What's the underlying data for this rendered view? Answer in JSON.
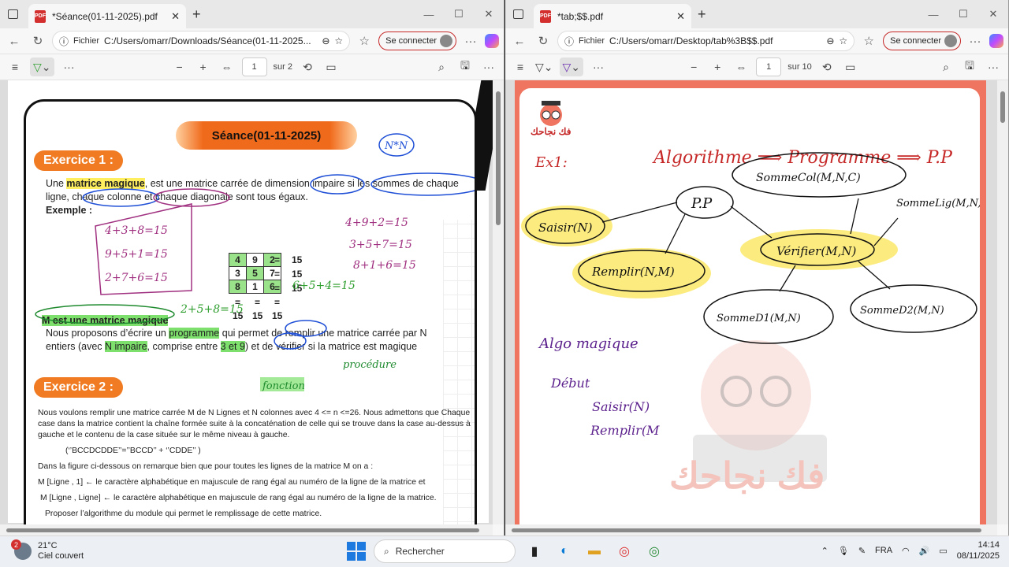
{
  "left": {
    "tab_title": "*Séance(01-11-2025).pdf",
    "addr_label": "Fichier",
    "url": "C:/Users/omarr/Downloads/Séance(01-11-2025...",
    "signin": "Se connecter",
    "page": "1",
    "page_total": "sur 2",
    "doc": {
      "seance_title": "Séance(01-11-2025)",
      "exo1": "Exercice 1 :",
      "l1a": "Une ",
      "l1b": "matrice magique",
      "l1c": ", est une matrice carrée de dimension impaire si les sommes de chaque",
      "l2": "ligne, chaque colonne et chaque diagonale sont tous égaux.",
      "exemple": "Exemple :",
      "matrix": [
        [
          "4",
          "9",
          "2"
        ],
        [
          "3",
          "5",
          "7"
        ],
        [
          "8",
          "1",
          "6"
        ]
      ],
      "row_eq": "=",
      "row_sum": "15",
      "col_sums": [
        "15",
        "15",
        "15"
      ],
      "magic": "M est une matrice magique",
      "p1a": "Nous proposons d’écrire un ",
      "p1b": "programme",
      "p1c": " qui permet de remplir une matrice carrée par N",
      "p2a": "entiers (avec ",
      "p2b": "N impaire",
      "p2c": ", comprise entre ",
      "p2d": "3 et 9",
      "p2e": ") et de vérifier si la matrice est magique",
      "exo2": "Exercice 2 :",
      "e2l1": "Nous voulons remplir une matrice carrée M de N Lignes et N colonnes avec 4 <= n <=26. Nous admettons que Chaque",
      "e2l2": "case dans la matrice contient la chaîne formée suite à la concaténation de celle qui se trouve dans la case au-dessus à",
      "e2l3": "gauche et  le contenu de  la case située  sur le même niveau à gauche.",
      "e2l4": "(‘’BCCDCDDE’’=’’BCCD’’ + ‘’CDDE’’ )",
      "e2l5": "Dans la figure ci-dessous on remarque bien que pour toutes les lignes de la matrice M on a :",
      "e2l6": "M [Ligne , 1] ← le caractère alphabétique en majuscule de rang égal au numéro de la  ligne de la matrice  et",
      "e2l7": "M [Ligne , Ligne] ←  le caractère alphabétique en majuscule de rang égal au numéro de la  ligne de la matrice.",
      "e2l8": "Proposer l’algorithme du module qui permet le remplissage de cette matrice.",
      "hw_nn": "N*N",
      "hw_sums": [
        "4+3+8=15",
        "9+5+1=15",
        "2+7+6=15"
      ],
      "hw_rows": [
        "4+9+2=15",
        "3+5+7=15",
        "8+1+6=15"
      ],
      "hw_diag1": "6+5+4=15",
      "hw_diag2": "2+5+8=15",
      "hw_fonction": "fonction",
      "hw_proc": "procédure"
    }
  },
  "right": {
    "tab_title": "*tab;$$.pdf",
    "addr_label": "Fichier",
    "url": "C:/Users/omarr/Desktop/tab%3B$$.pdf",
    "signin": "Se connecter",
    "page": "1",
    "page_total": "sur 10",
    "doc": {
      "brand": "فك نجاحك",
      "ex1": "Ex1:",
      "algo": "Algorithme ⟹ Programme ⟹ P.P",
      "pp": "P.P",
      "saisir": "Saisir(N)",
      "remplir": "Remplir(N,M)",
      "verifier": "Vérifier(M,N)",
      "somme_col": "SommeCol(M,N,C)",
      "somme_lig": "SommeLig(M,N,L)",
      "somme_d1": "SommeD1(M,N)",
      "somme_d2": "SommeD2(M,N)",
      "algo_magique": "Algo magique",
      "debut": "Début",
      "s1": "Saisir(N)",
      "s2": "Remplir(M"
    }
  },
  "taskbar": {
    "weather_badge": "2",
    "temp": "21°C",
    "weather": "Ciel couvert",
    "search": "Rechercher",
    "lang": "FRA",
    "time": "14:14",
    "date": "08/11/2025"
  }
}
